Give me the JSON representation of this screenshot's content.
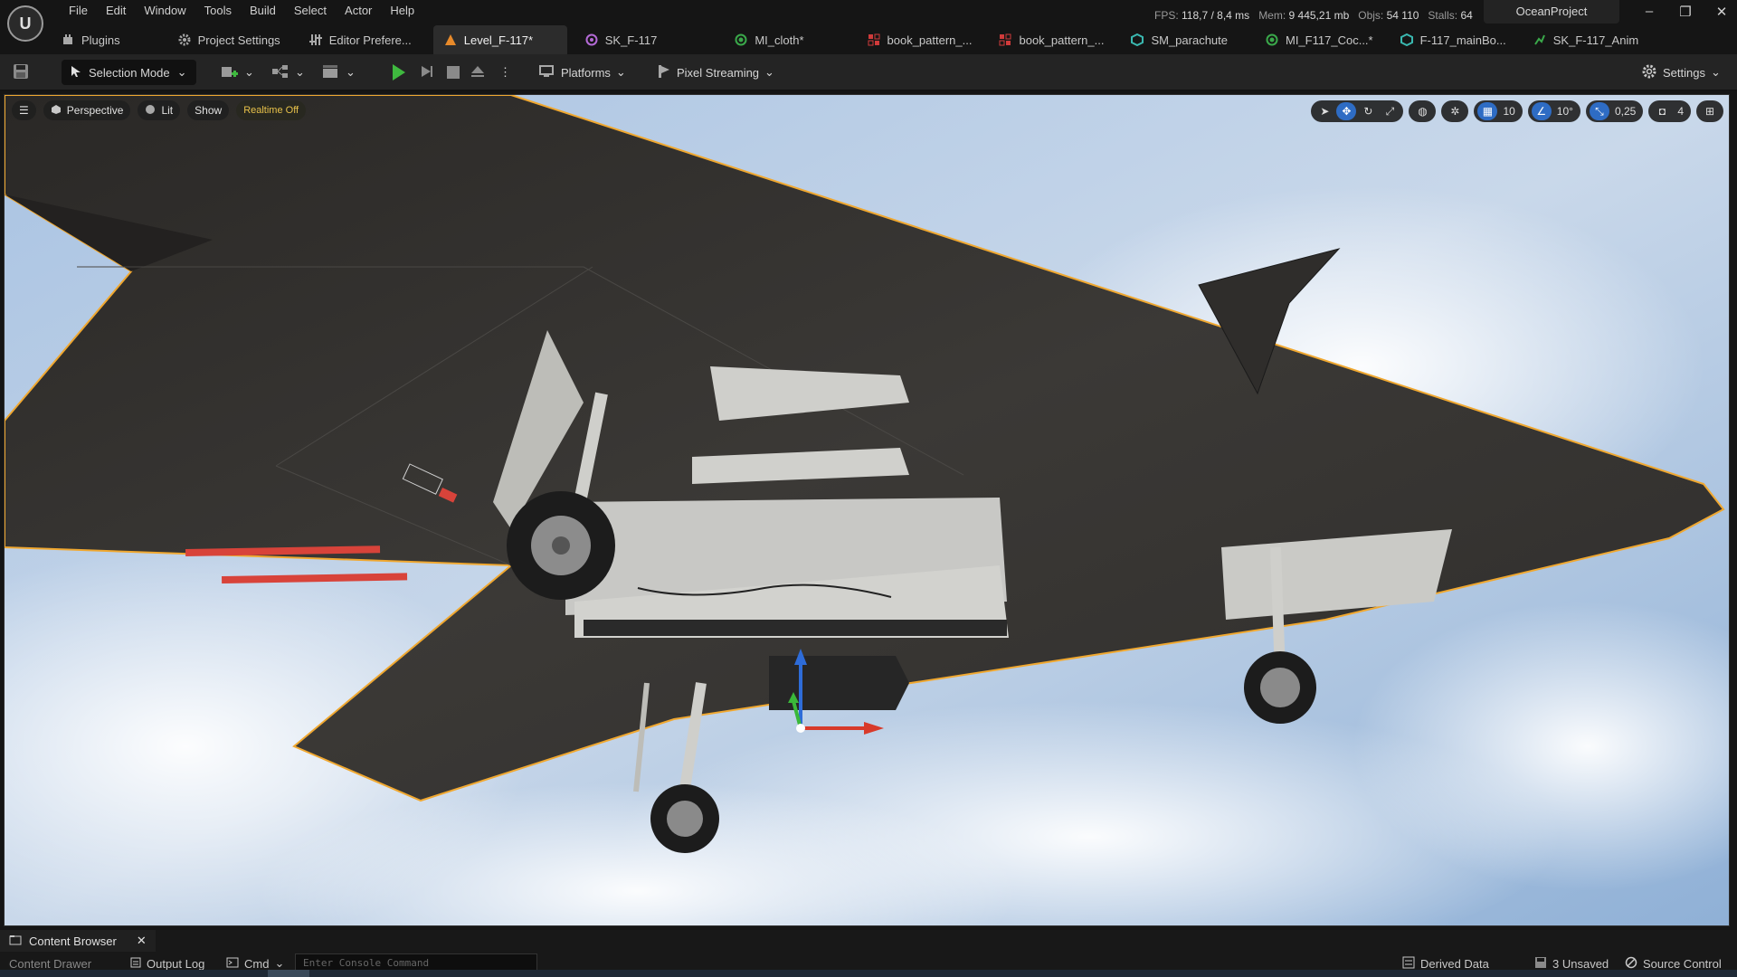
{
  "menu": {
    "logo_letter": "U",
    "items": [
      "File",
      "Edit",
      "Window",
      "Tools",
      "Build",
      "Select",
      "Actor",
      "Help"
    ]
  },
  "stats": {
    "fps_label": "FPS:",
    "fps": "118,7",
    "ms": "/ 8,4 ms",
    "mem_label": "Mem:",
    "mem": "9 445,21 mb",
    "objs_label": "Objs:",
    "objs": "54 110",
    "stalls_label": "Stalls:",
    "stalls": "64"
  },
  "project_name": "OceanProject",
  "window_buttons": {
    "minimize": "–",
    "restore": "❐",
    "close": "✕"
  },
  "tabs": [
    {
      "label": "Plugins",
      "icon": "plugin-icon",
      "color": "#a8a8a8"
    },
    {
      "label": "Project Settings",
      "icon": "gear-icon",
      "color": "#a8a8a8"
    },
    {
      "label": "Editor Prefere...",
      "icon": "sliders-icon",
      "color": "#a8a8a8"
    },
    {
      "label": "Level_F-117*",
      "icon": "level-icon",
      "color": "#e88a2a",
      "active": true
    },
    {
      "label": "SK_F-117",
      "icon": "skeleton-icon",
      "color": "#b46ad6"
    },
    {
      "label": "MI_cloth*",
      "icon": "material-instance-icon",
      "color": "#3aa84a"
    },
    {
      "label": "book_pattern_...",
      "icon": "texture-icon",
      "color": "#d03a3a"
    },
    {
      "label": "book_pattern_...",
      "icon": "texture-icon",
      "color": "#d03a3a"
    },
    {
      "label": "SM_parachute",
      "icon": "static-mesh-icon",
      "color": "#3ab8b0"
    },
    {
      "label": "MI_F117_Coc...*",
      "icon": "material-instance-icon",
      "color": "#3aa84a"
    },
    {
      "label": "F-117_mainBo...",
      "icon": "static-mesh-icon",
      "color": "#3ab8b0"
    },
    {
      "label": "SK_F-117_Anim",
      "icon": "animation-icon",
      "color": "#3aa84a"
    }
  ],
  "toolbar": {
    "mode_label": "Selection Mode",
    "platforms_label": "Platforms",
    "pixel_streaming_label": "Pixel Streaming",
    "settings_label": "Settings"
  },
  "viewport": {
    "perspective_label": "Perspective",
    "lit_label": "Lit",
    "show_label": "Show",
    "realtime_label": "Realtime Off",
    "grid_snap": "10",
    "rotation_snap": "10°",
    "scale_snap": "0,25",
    "camera_speed": "4"
  },
  "bottom": {
    "content_browser_label": "Content Browser",
    "content_drawer_label": "Content Drawer",
    "output_log_label": "Output Log",
    "cmd_label": "Cmd",
    "console_placeholder": "Enter Console Command",
    "derived_data_label": "Derived Data",
    "unsaved_label": "3 Unsaved",
    "source_control_label": "Source Control"
  },
  "colors": {
    "selection_outline": "#f0a830",
    "accent_blue": "#2e6cc4",
    "play_green": "#3fb93f"
  }
}
